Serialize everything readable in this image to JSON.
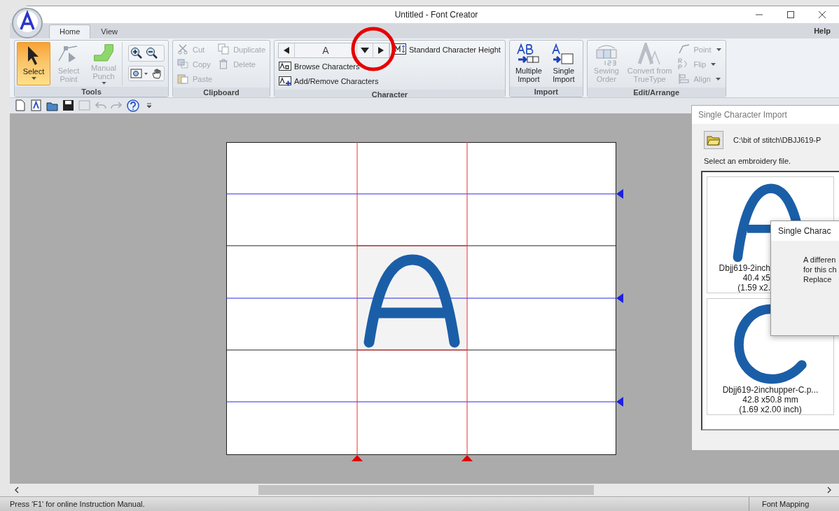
{
  "window": {
    "title": "Untitled - Font Creator"
  },
  "ribbon": {
    "tabs": [
      {
        "label": "Home",
        "selected": true
      },
      {
        "label": "View",
        "selected": false
      }
    ],
    "help": "Help",
    "groups": [
      {
        "title": "Tools",
        "columns": [
          [
            {
              "kind": "large",
              "label": "Select",
              "selected": true,
              "disabled": false,
              "dropdown": true
            }
          ],
          [
            {
              "kind": "large",
              "label": "Select\nPoint",
              "selected": false,
              "disabled": true,
              "dropdown": false
            }
          ],
          [
            {
              "kind": "large",
              "label": "Manual\nPunch",
              "selected": false,
              "disabled": true,
              "dropdown": true
            }
          ],
          [
            {
              "kind": "zoom"
            }
          ]
        ]
      },
      {
        "title": "Clipboard",
        "columns": [
          [
            {
              "kind": "small",
              "label": "Cut",
              "disabled": true,
              "dropdown": false
            },
            {
              "kind": "small",
              "label": "Copy",
              "disabled": true,
              "dropdown": false
            },
            {
              "kind": "small",
              "label": "Paste",
              "disabled": true,
              "dropdown": false
            }
          ],
          [
            {
              "kind": "small",
              "label": "Duplicate",
              "disabled": true,
              "dropdown": false
            },
            {
              "kind": "small",
              "label": "Delete",
              "disabled": true,
              "dropdown": false
            }
          ]
        ]
      },
      {
        "title": "Character",
        "columns": [
          [
            {
              "kind": "nav",
              "value": "A"
            },
            {
              "kind": "small",
              "label": "Browse Characters",
              "disabled": false,
              "dropdown": false
            },
            {
              "kind": "small",
              "label": "Add/Remove Characters",
              "disabled": false,
              "dropdown": false
            }
          ],
          [
            {
              "kind": "small",
              "label": "Standard Character Height",
              "disabled": false,
              "dropdown": false
            }
          ]
        ]
      },
      {
        "title": "Import",
        "columns": [
          [
            {
              "kind": "large",
              "label": "Multiple\nImport",
              "selected": false,
              "disabled": false,
              "dropdown": false
            }
          ],
          [
            {
              "kind": "large",
              "label": "Single\nImport",
              "selected": false,
              "disabled": false,
              "dropdown": false
            }
          ]
        ]
      },
      {
        "title": "Edit/Arrange",
        "columns": [
          [
            {
              "kind": "large",
              "label": "Sewing\nOrder",
              "selected": false,
              "disabled": true,
              "dropdown": false
            }
          ],
          [
            {
              "kind": "large",
              "label": "Convert from\nTrueType",
              "selected": false,
              "disabled": true,
              "dropdown": false
            }
          ],
          [
            {
              "kind": "small",
              "label": "Point",
              "disabled": true,
              "dropdown": true
            },
            {
              "kind": "small",
              "label": "Flip",
              "disabled": true,
              "dropdown": true
            },
            {
              "kind": "small",
              "label": "Align",
              "disabled": true,
              "dropdown": true
            }
          ]
        ]
      }
    ]
  },
  "import_dialog": {
    "title": "Single Character Import",
    "path": "C:\\bit of stitch\\DBJJ619-P",
    "hint": "Select an embroidery file.",
    "files": [
      {
        "name": "Dbjj619-2inch",
        "size_mm": "40.4 x5",
        "size_inch": "(1.59 x2.",
        "partly_covered": true
      },
      {
        "name": "Dbjj619-2inchupper-C.p...",
        "size_mm": "42.8 x50.8 mm",
        "size_inch": "(1.69 x2.00 inch)",
        "partly_covered": false
      }
    ]
  },
  "message_dialog": {
    "title": "Single Charac",
    "lines": [
      "A differen",
      "for this ch",
      "Replace"
    ]
  },
  "status_bar": {
    "message": "Press 'F1' for online Instruction Manual.",
    "panel": "Font Mapping"
  }
}
